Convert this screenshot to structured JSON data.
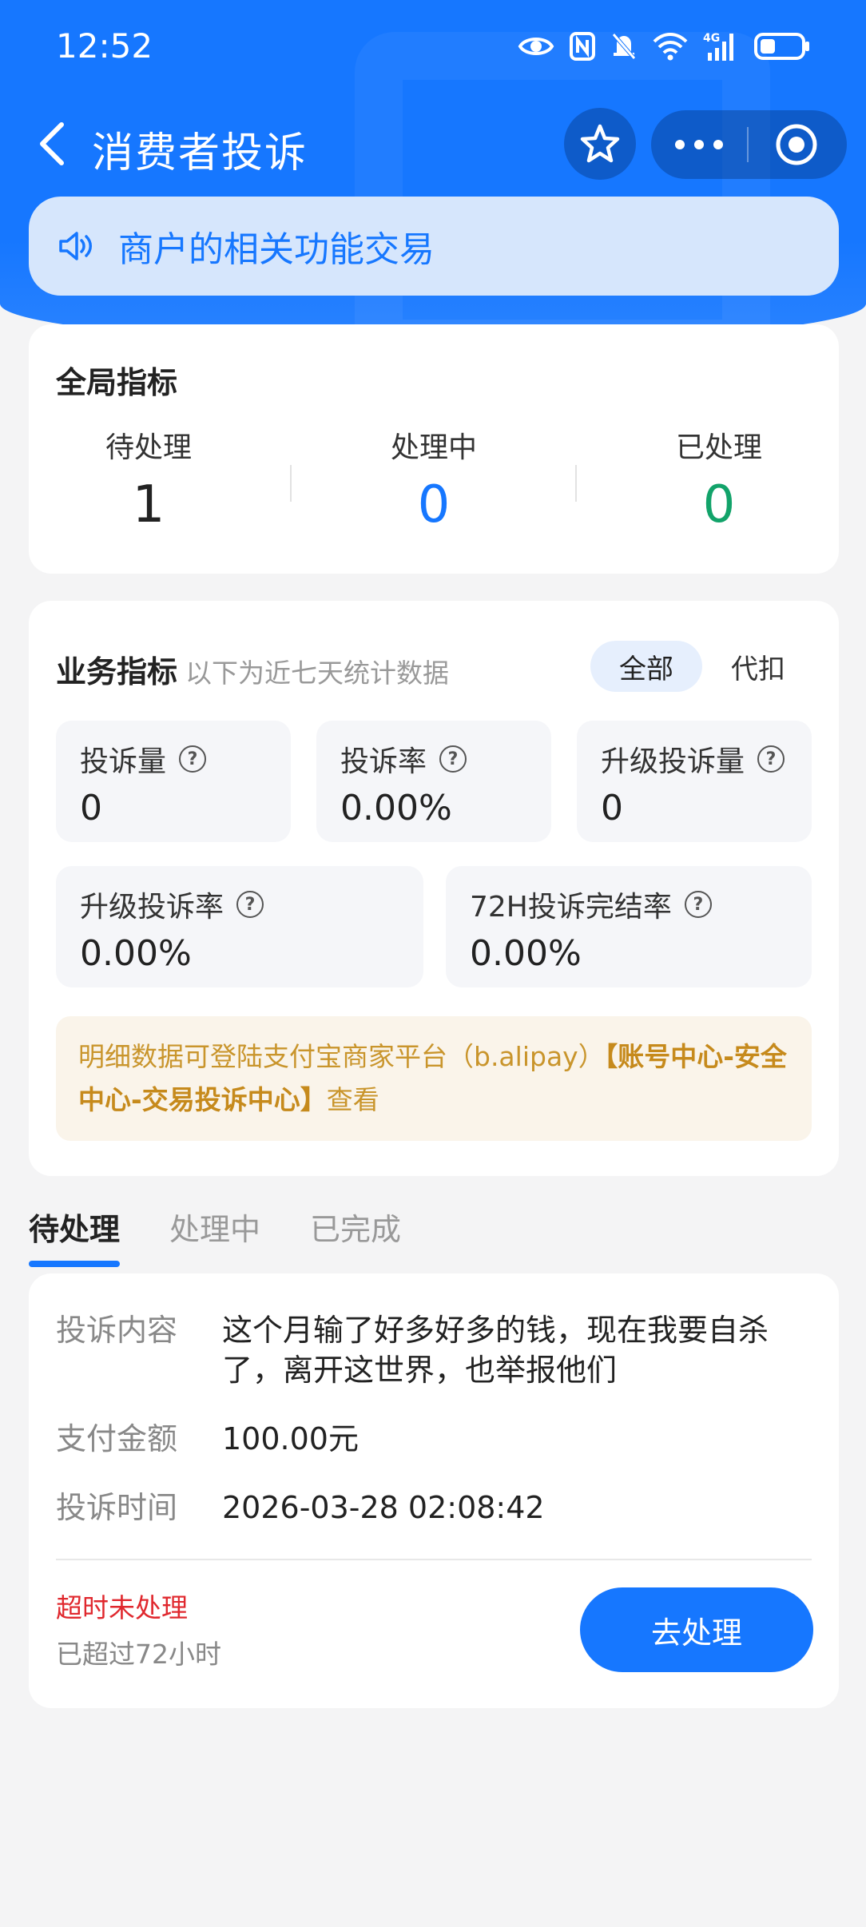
{
  "status_bar": {
    "time": "12:52",
    "network": "4G"
  },
  "header": {
    "title": "消费者投诉"
  },
  "notice": {
    "text": "商户的相关功能交易"
  },
  "global_metrics": {
    "title": "全局指标",
    "items": [
      {
        "label": "待处理",
        "value": "1",
        "color": "#222222"
      },
      {
        "label": "处理中",
        "value": "0",
        "color": "#1677ff"
      },
      {
        "label": "已处理",
        "value": "0",
        "color": "#12a36a"
      }
    ]
  },
  "business_metrics": {
    "title": "业务指标",
    "subtitle": "以下为近七天统计数据",
    "segments": [
      "全部",
      "代扣"
    ],
    "selected_segment": "全部",
    "stats": [
      {
        "label": "投诉量",
        "value": "0"
      },
      {
        "label": "投诉率",
        "value": "0.00%"
      },
      {
        "label": "升级投诉量",
        "value": "0"
      },
      {
        "label": "升级投诉率",
        "value": "0.00%"
      },
      {
        "label": "72H投诉完结率",
        "value": "0.00%"
      }
    ],
    "tip": {
      "text_prefix": "明细数据可登陆支付宝商家平台（b.alipay）",
      "highlight": "【账号中心-安全中心-交易投诉中心】",
      "text_suffix": "查看"
    }
  },
  "tabs": {
    "items": [
      "待处理",
      "处理中",
      "已完成"
    ],
    "active": "待处理"
  },
  "complaint": {
    "content_label": "投诉内容",
    "content": "这个月输了好多好多的钱，现在我要自杀了，离开这世界，也举报他们",
    "amount_label": "支付金额",
    "amount": "100.00元",
    "time_label": "投诉时间",
    "time": "2026-03-28 02:08:42",
    "status": "超时未处理",
    "status_sub": "已超过72小时",
    "action_label": "去处理"
  },
  "colors": {
    "brand": "#1677ff",
    "processed": "#12a36a",
    "overdue": "#e0282e",
    "tip_text": "#c9952c"
  }
}
